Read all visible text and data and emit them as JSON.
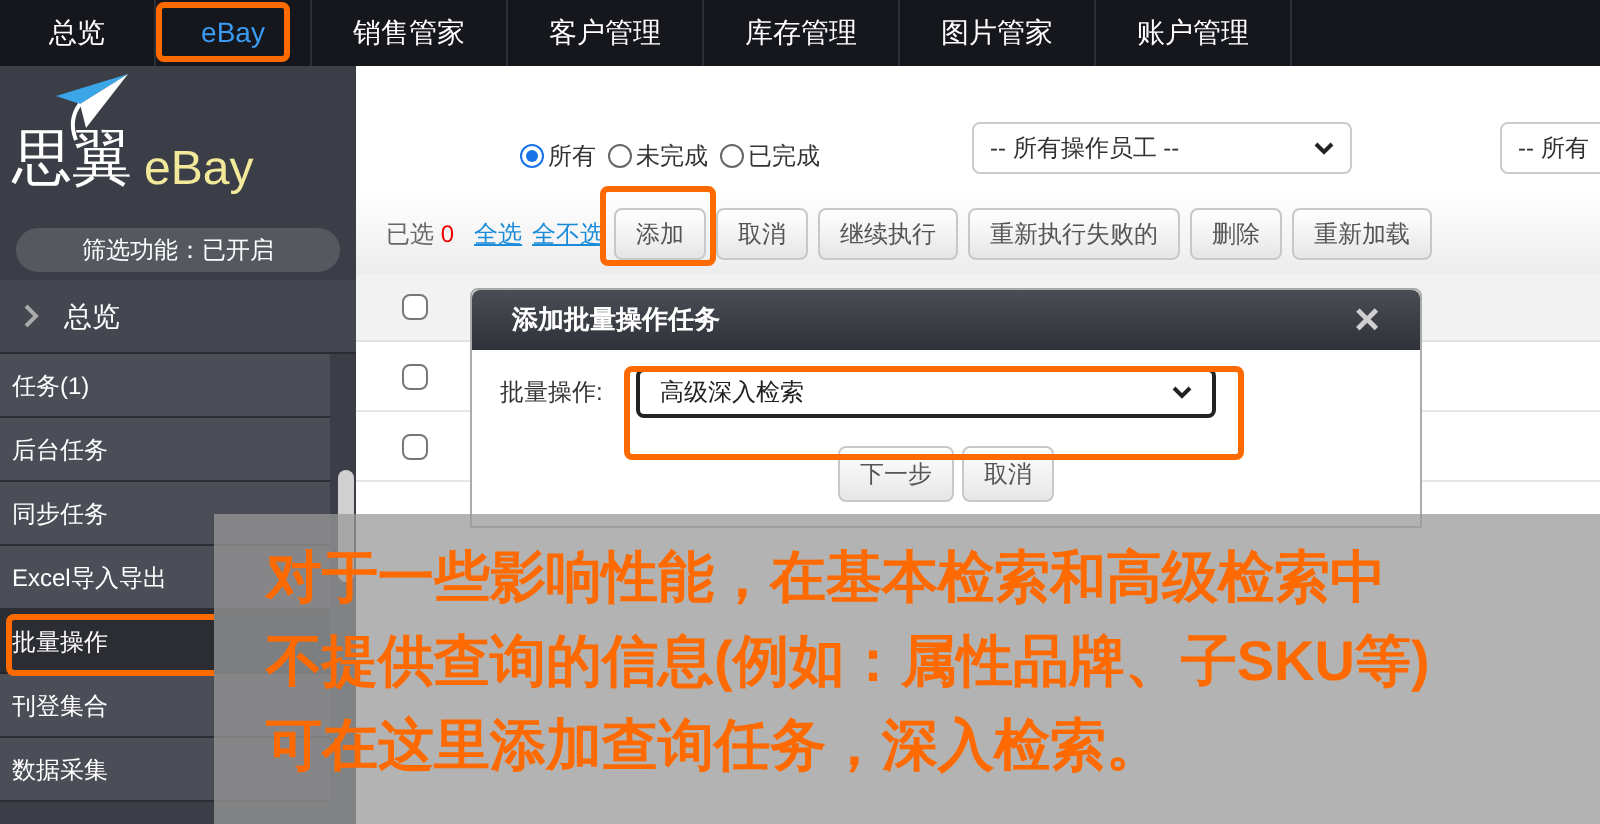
{
  "nav": {
    "items": [
      {
        "label": "总览",
        "selected": false
      },
      {
        "label": "eBay",
        "selected": true
      },
      {
        "label": "销售管家",
        "selected": false
      },
      {
        "label": "客户管理",
        "selected": false
      },
      {
        "label": "库存管理",
        "selected": false
      },
      {
        "label": "图片管家",
        "selected": false
      },
      {
        "label": "账户管理",
        "selected": false
      }
    ]
  },
  "sidebar": {
    "logo_name": "思翼",
    "logo_brand": "eBay",
    "filter_status": "筛选功能：已开启",
    "overview": "总览",
    "items": [
      {
        "label": "任务(1)",
        "selected": false
      },
      {
        "label": "后台任务",
        "selected": false
      },
      {
        "label": "同步任务",
        "selected": false
      },
      {
        "label": "Excel导入导出",
        "selected": false
      },
      {
        "label": "批量操作",
        "selected": true
      },
      {
        "label": "刊登集合",
        "selected": false
      },
      {
        "label": "数据采集",
        "selected": false
      }
    ]
  },
  "filters": {
    "radios": [
      {
        "label": "所有",
        "selected": true
      },
      {
        "label": "未完成",
        "selected": false
      },
      {
        "label": "已完成",
        "selected": false
      }
    ],
    "selects": [
      "-- 所有操作员工 --",
      "-- 所有"
    ]
  },
  "toolbar": {
    "selected_label": "已选",
    "selected_count": "0",
    "links": [
      "全选",
      "全不选"
    ],
    "buttons": [
      "添加",
      "取消",
      "继续执行",
      "重新执行失败的",
      "删除",
      "重新加载"
    ]
  },
  "table": {
    "rows": [
      {
        "checked": false
      },
      {
        "checked": false
      },
      {
        "checked": false
      }
    ]
  },
  "dialog": {
    "title": "添加批量操作任务",
    "close": "×",
    "field_label": "批量操作:",
    "field_value": "高级深入检索",
    "buttons": [
      "下一步",
      "取消"
    ]
  },
  "annotation": {
    "lines": [
      "对于一些影响性能，在基本检索和高级检索中",
      "不提供查询的信息(例如：属性品牌、子SKU等)",
      "可在这里添加查询任务，深入检索。"
    ]
  }
}
